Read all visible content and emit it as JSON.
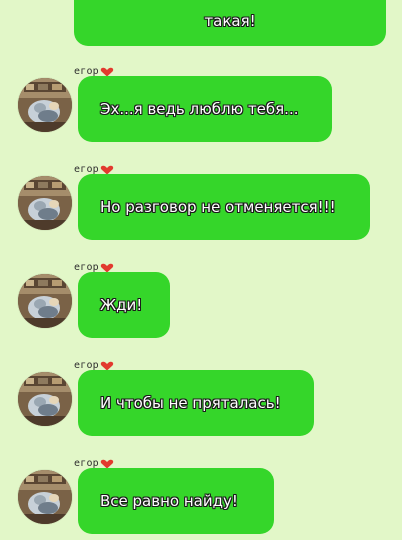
{
  "colors": {
    "background": "#e2f7c8",
    "bubble": "#35d62a",
    "text": "#ffffff",
    "text_outline": "#1b1b1b",
    "heart": "#e23a2e"
  },
  "top_message": {
    "text": "такая!"
  },
  "messages": [
    {
      "sender": "егор",
      "text": "Эх...я ведь люблю тебя..."
    },
    {
      "sender": "егор",
      "text": "Но разговор не отменяется!!!"
    },
    {
      "sender": "егор",
      "text": "Жди!"
    },
    {
      "sender": "егор",
      "text": "И чтобы не пряталась!"
    },
    {
      "sender": "егор",
      "text": "Все равно найду!"
    }
  ],
  "icons": {
    "heart": "heart-icon",
    "avatar": "avatar-photo"
  }
}
